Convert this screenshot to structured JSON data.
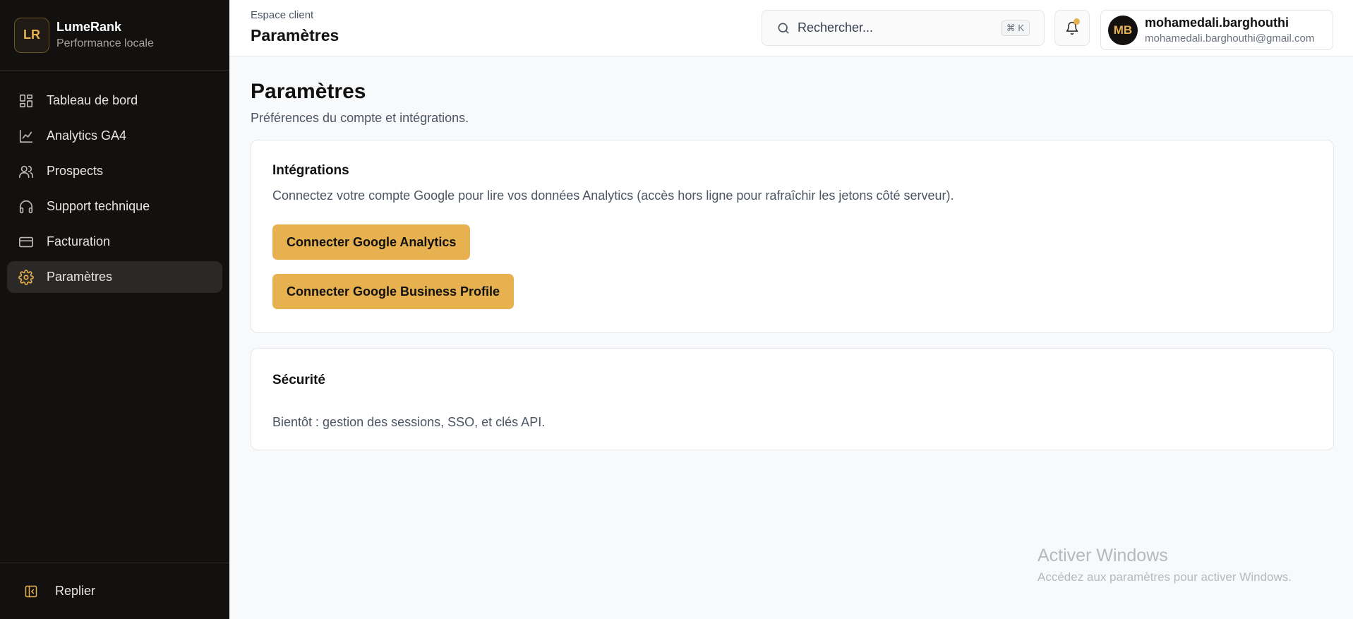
{
  "brand": {
    "logo": "LR",
    "name": "LumeRank",
    "subtitle": "Performance locale"
  },
  "sidebar": {
    "items": [
      {
        "label": "Tableau de bord",
        "icon": "dashboard-icon",
        "active": false
      },
      {
        "label": "Analytics GA4",
        "icon": "line-chart-icon",
        "active": false
      },
      {
        "label": "Prospects",
        "icon": "users-icon",
        "active": false
      },
      {
        "label": "Support technique",
        "icon": "headphones-icon",
        "active": false
      },
      {
        "label": "Facturation",
        "icon": "credit-card-icon",
        "active": false
      },
      {
        "label": "Paramètres",
        "icon": "gear-icon",
        "active": true
      }
    ],
    "collapse_label": "Replier"
  },
  "header": {
    "breadcrumb": "Espace client",
    "title": "Paramètres",
    "search_placeholder": "Rechercher...",
    "search_shortcut": "⌘ K"
  },
  "user": {
    "initials": "MB",
    "name": "mohamedali.barghouthi",
    "email": "mohamedali.barghouthi@gmail.com"
  },
  "main": {
    "title": "Paramètres",
    "subtitle": "Préférences du compte et intégrations.",
    "integrations": {
      "title": "Intégrations",
      "description": "Connectez votre compte Google pour lire vos données Analytics (accès hors ligne pour rafraîchir les jetons côté serveur).",
      "ga_button": "Connecter Google Analytics",
      "gbp_button": "Connecter Google Business Profile"
    },
    "security": {
      "title": "Sécurité",
      "description": "Bientôt : gestion des sessions, SSO, et clés API."
    }
  },
  "watermark": {
    "title": "Activer Windows",
    "subtitle": "Accédez aux paramètres pour activer Windows."
  },
  "colors": {
    "accent": "#e8b14f",
    "sidebar_bg": "#121110",
    "page_bg": "#f8f9fb"
  }
}
